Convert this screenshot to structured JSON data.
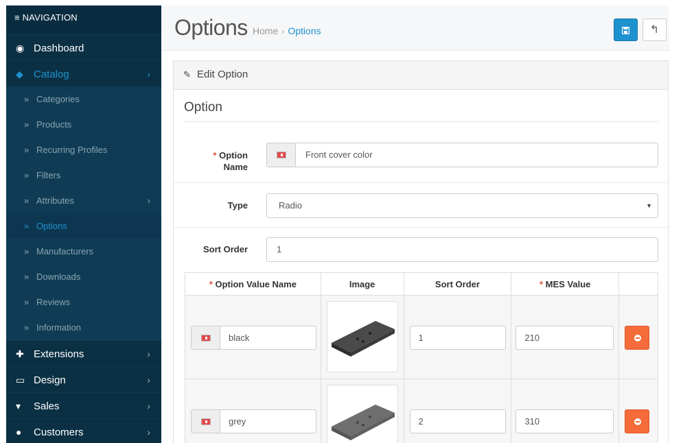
{
  "sidebar": {
    "header": "≡ NAVIGATION",
    "dashboard": "Dashboard",
    "catalog": "Catalog",
    "catalog_sub": [
      "Categories",
      "Products",
      "Recurring Profiles",
      "Filters",
      "Attributes",
      "Options",
      "Manufacturers",
      "Downloads",
      "Reviews",
      "Information"
    ],
    "extensions": "Extensions",
    "design": "Design",
    "sales": "Sales",
    "customers": "Customers"
  },
  "header": {
    "title": "Options",
    "breadcrumb_home": "Home",
    "breadcrumb_sep": "›",
    "breadcrumb_current": "Options"
  },
  "panel": {
    "heading": "Edit Option",
    "legend": "Option",
    "option_name_label_1": "Option",
    "option_name_label_2": "Name",
    "option_name_value": "Front cover color",
    "type_label": "Type",
    "type_value": "Radio",
    "sort_order_label": "Sort Order",
    "sort_order_value": "1",
    "required_marker": "*"
  },
  "table": {
    "col_name": "Option Value Name",
    "col_image": "Image",
    "col_sort": "Sort Order",
    "col_mes": "MES Value",
    "rows": [
      {
        "name": "black",
        "sort": "1",
        "mes": "210"
      },
      {
        "name": "grey",
        "sort": "2",
        "mes": "310"
      }
    ]
  },
  "colors": {
    "sidebar_bg": "#0c3349",
    "accent": "#1e91cf",
    "danger": "#f56b3a",
    "required": "#e3503e"
  },
  "icons": {
    "dashboard": "dashboard-icon",
    "catalog": "tag-icon",
    "extensions": "puzzle-icon",
    "design": "monitor-icon",
    "sales": "cart-icon",
    "customers": "user-icon",
    "save": "save-icon",
    "back": "reply-icon",
    "edit": "pencil-icon",
    "remove": "minus-circle-icon"
  }
}
